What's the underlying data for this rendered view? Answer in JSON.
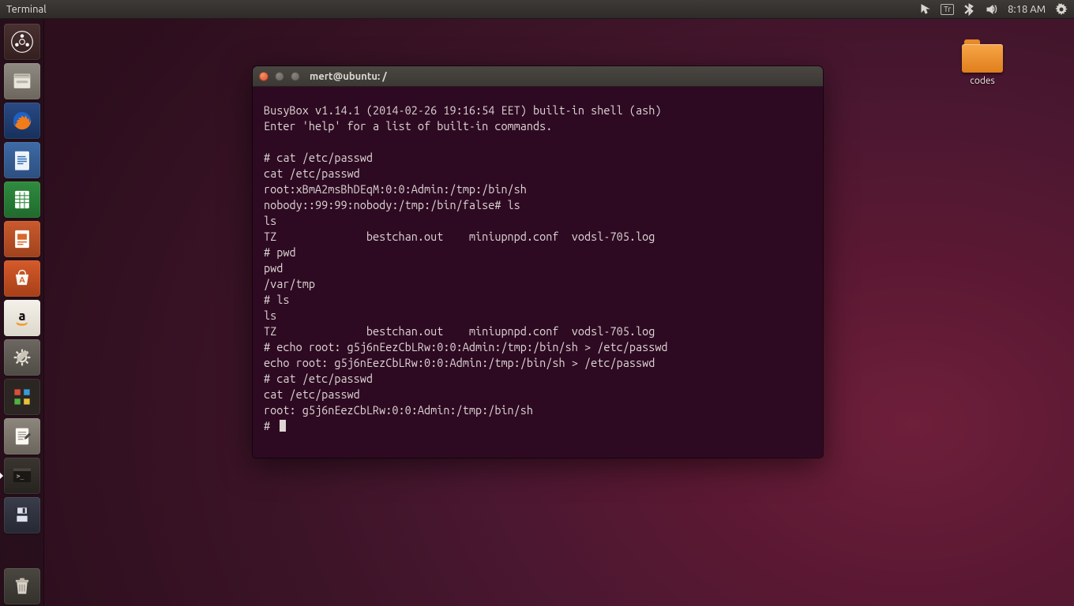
{
  "top_panel": {
    "app_label": "Terminal",
    "keyboard_layout": "Tr",
    "clock": "8:18 AM"
  },
  "launcher_items": [
    {
      "name": "dash"
    },
    {
      "name": "files"
    },
    {
      "name": "firefox"
    },
    {
      "name": "libreoffice-writer"
    },
    {
      "name": "libreoffice-calc"
    },
    {
      "name": "libreoffice-impress"
    },
    {
      "name": "ubuntu-software"
    },
    {
      "name": "amazon"
    },
    {
      "name": "settings"
    },
    {
      "name": "app-grid"
    },
    {
      "name": "text-editor"
    },
    {
      "name": "terminal"
    },
    {
      "name": "save-disk"
    }
  ],
  "desktop": {
    "folder_label": "codes"
  },
  "window": {
    "title": "mert@ubuntu: /"
  },
  "terminal": {
    "lines": [
      "BusyBox v1.14.1 (2014-02-26 19:16:54 EET) built-in shell (ash)",
      "Enter 'help' for a list of built-in commands.",
      "",
      "# cat /etc/passwd",
      "cat /etc/passwd",
      "root:xBmA2msBhDEqM:0:0:Admin:/tmp:/bin/sh",
      "nobody::99:99:nobody:/tmp:/bin/false# ls",
      "ls",
      "TZ              bestchan.out    miniupnpd.conf  vodsl-705.log",
      "# pwd",
      "pwd",
      "/var/tmp",
      "# ls",
      "ls",
      "TZ              bestchan.out    miniupnpd.conf  vodsl-705.log",
      "# echo root: g5j6nEezCbLRw:0:0:Admin:/tmp:/bin/sh > /etc/passwd",
      "echo root: g5j6nEezCbLRw:0:0:Admin:/tmp:/bin/sh > /etc/passwd",
      "# cat /etc/passwd",
      "cat /etc/passwd",
      "root: g5j6nEezCbLRw:0:0:Admin:/tmp:/bin/sh",
      "# "
    ]
  }
}
